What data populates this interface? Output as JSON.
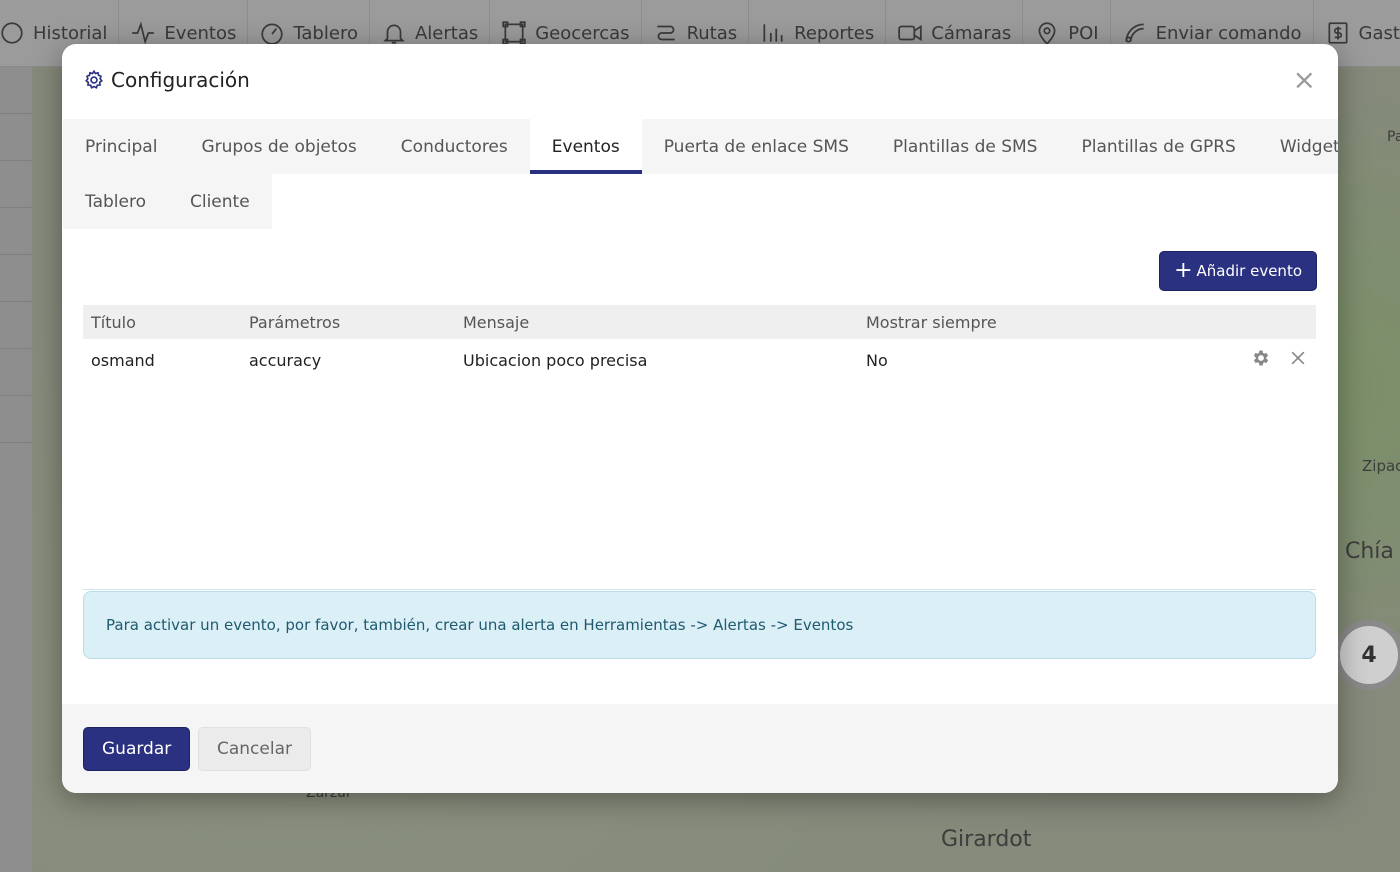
{
  "topbar": {
    "items": [
      {
        "label": "Historial",
        "icon": "history-icon"
      },
      {
        "label": "Eventos",
        "icon": "activity-icon"
      },
      {
        "label": "Tablero",
        "icon": "gauge-icon"
      },
      {
        "label": "Alertas",
        "icon": "bell-icon"
      },
      {
        "label": "Geocercas",
        "icon": "geofence-icon"
      },
      {
        "label": "Rutas",
        "icon": "route-icon"
      },
      {
        "label": "Reportes",
        "icon": "chart-icon"
      },
      {
        "label": "Cámaras",
        "icon": "camera-icon"
      },
      {
        "label": "POI",
        "icon": "pin-icon"
      },
      {
        "label": "Enviar comando",
        "icon": "signal-icon"
      },
      {
        "label": "Gastos",
        "icon": "dollar-icon"
      }
    ]
  },
  "map": {
    "labels": [
      "Chía",
      "Girardot",
      "Zipac",
      "Zarzal",
      "Pa"
    ],
    "cluster_count": "4"
  },
  "modal": {
    "title": "Configuración",
    "close": "×",
    "tabs_row1": [
      "Principal",
      "Grupos de objetos",
      "Conductores",
      "Eventos",
      "Puerta de enlace SMS",
      "Plantillas de SMS",
      "Plantillas de GPRS",
      "Widgets"
    ],
    "tabs_row2": [
      "Tablero",
      "Cliente"
    ],
    "active_tab": "Eventos",
    "add_button": "Añadir evento",
    "table": {
      "headers": [
        "Título",
        "Parámetros",
        "Mensaje",
        "Mostrar siempre"
      ],
      "rows": [
        {
          "titulo": "osmand",
          "parametros": "accuracy",
          "mensaje": "Ubicacion poco precisa",
          "mostrar": "No"
        }
      ]
    },
    "info": "Para activar un evento, por favor, también, crear una alerta en Herramientas -> Alertas -> Eventos",
    "save": "Guardar",
    "cancel": "Cancelar"
  },
  "colors": {
    "primary": "#2a3180",
    "info_bg": "#dbeff7",
    "info_text": "#1f5a6e"
  }
}
